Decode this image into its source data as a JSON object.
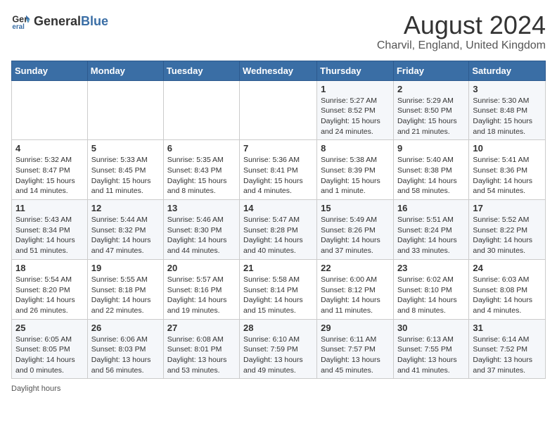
{
  "header": {
    "logo_general": "General",
    "logo_blue": "Blue",
    "title": "August 2024",
    "subtitle": "Charvil, England, United Kingdom"
  },
  "weekdays": [
    "Sunday",
    "Monday",
    "Tuesday",
    "Wednesday",
    "Thursday",
    "Friday",
    "Saturday"
  ],
  "weeks": [
    [
      {
        "day": "",
        "info": ""
      },
      {
        "day": "",
        "info": ""
      },
      {
        "day": "",
        "info": ""
      },
      {
        "day": "",
        "info": ""
      },
      {
        "day": "1",
        "info": "Sunrise: 5:27 AM\nSunset: 8:52 PM\nDaylight: 15 hours and 24 minutes."
      },
      {
        "day": "2",
        "info": "Sunrise: 5:29 AM\nSunset: 8:50 PM\nDaylight: 15 hours and 21 minutes."
      },
      {
        "day": "3",
        "info": "Sunrise: 5:30 AM\nSunset: 8:48 PM\nDaylight: 15 hours and 18 minutes."
      }
    ],
    [
      {
        "day": "4",
        "info": "Sunrise: 5:32 AM\nSunset: 8:47 PM\nDaylight: 15 hours and 14 minutes."
      },
      {
        "day": "5",
        "info": "Sunrise: 5:33 AM\nSunset: 8:45 PM\nDaylight: 15 hours and 11 minutes."
      },
      {
        "day": "6",
        "info": "Sunrise: 5:35 AM\nSunset: 8:43 PM\nDaylight: 15 hours and 8 minutes."
      },
      {
        "day": "7",
        "info": "Sunrise: 5:36 AM\nSunset: 8:41 PM\nDaylight: 15 hours and 4 minutes."
      },
      {
        "day": "8",
        "info": "Sunrise: 5:38 AM\nSunset: 8:39 PM\nDaylight: 15 hours and 1 minute."
      },
      {
        "day": "9",
        "info": "Sunrise: 5:40 AM\nSunset: 8:38 PM\nDaylight: 14 hours and 58 minutes."
      },
      {
        "day": "10",
        "info": "Sunrise: 5:41 AM\nSunset: 8:36 PM\nDaylight: 14 hours and 54 minutes."
      }
    ],
    [
      {
        "day": "11",
        "info": "Sunrise: 5:43 AM\nSunset: 8:34 PM\nDaylight: 14 hours and 51 minutes."
      },
      {
        "day": "12",
        "info": "Sunrise: 5:44 AM\nSunset: 8:32 PM\nDaylight: 14 hours and 47 minutes."
      },
      {
        "day": "13",
        "info": "Sunrise: 5:46 AM\nSunset: 8:30 PM\nDaylight: 14 hours and 44 minutes."
      },
      {
        "day": "14",
        "info": "Sunrise: 5:47 AM\nSunset: 8:28 PM\nDaylight: 14 hours and 40 minutes."
      },
      {
        "day": "15",
        "info": "Sunrise: 5:49 AM\nSunset: 8:26 PM\nDaylight: 14 hours and 37 minutes."
      },
      {
        "day": "16",
        "info": "Sunrise: 5:51 AM\nSunset: 8:24 PM\nDaylight: 14 hours and 33 minutes."
      },
      {
        "day": "17",
        "info": "Sunrise: 5:52 AM\nSunset: 8:22 PM\nDaylight: 14 hours and 30 minutes."
      }
    ],
    [
      {
        "day": "18",
        "info": "Sunrise: 5:54 AM\nSunset: 8:20 PM\nDaylight: 14 hours and 26 minutes."
      },
      {
        "day": "19",
        "info": "Sunrise: 5:55 AM\nSunset: 8:18 PM\nDaylight: 14 hours and 22 minutes."
      },
      {
        "day": "20",
        "info": "Sunrise: 5:57 AM\nSunset: 8:16 PM\nDaylight: 14 hours and 19 minutes."
      },
      {
        "day": "21",
        "info": "Sunrise: 5:58 AM\nSunset: 8:14 PM\nDaylight: 14 hours and 15 minutes."
      },
      {
        "day": "22",
        "info": "Sunrise: 6:00 AM\nSunset: 8:12 PM\nDaylight: 14 hours and 11 minutes."
      },
      {
        "day": "23",
        "info": "Sunrise: 6:02 AM\nSunset: 8:10 PM\nDaylight: 14 hours and 8 minutes."
      },
      {
        "day": "24",
        "info": "Sunrise: 6:03 AM\nSunset: 8:08 PM\nDaylight: 14 hours and 4 minutes."
      }
    ],
    [
      {
        "day": "25",
        "info": "Sunrise: 6:05 AM\nSunset: 8:05 PM\nDaylight: 14 hours and 0 minutes."
      },
      {
        "day": "26",
        "info": "Sunrise: 6:06 AM\nSunset: 8:03 PM\nDaylight: 13 hours and 56 minutes."
      },
      {
        "day": "27",
        "info": "Sunrise: 6:08 AM\nSunset: 8:01 PM\nDaylight: 13 hours and 53 minutes."
      },
      {
        "day": "28",
        "info": "Sunrise: 6:10 AM\nSunset: 7:59 PM\nDaylight: 13 hours and 49 minutes."
      },
      {
        "day": "29",
        "info": "Sunrise: 6:11 AM\nSunset: 7:57 PM\nDaylight: 13 hours and 45 minutes."
      },
      {
        "day": "30",
        "info": "Sunrise: 6:13 AM\nSunset: 7:55 PM\nDaylight: 13 hours and 41 minutes."
      },
      {
        "day": "31",
        "info": "Sunrise: 6:14 AM\nSunset: 7:52 PM\nDaylight: 13 hours and 37 minutes."
      }
    ]
  ],
  "footer": {
    "note": "Daylight hours"
  }
}
